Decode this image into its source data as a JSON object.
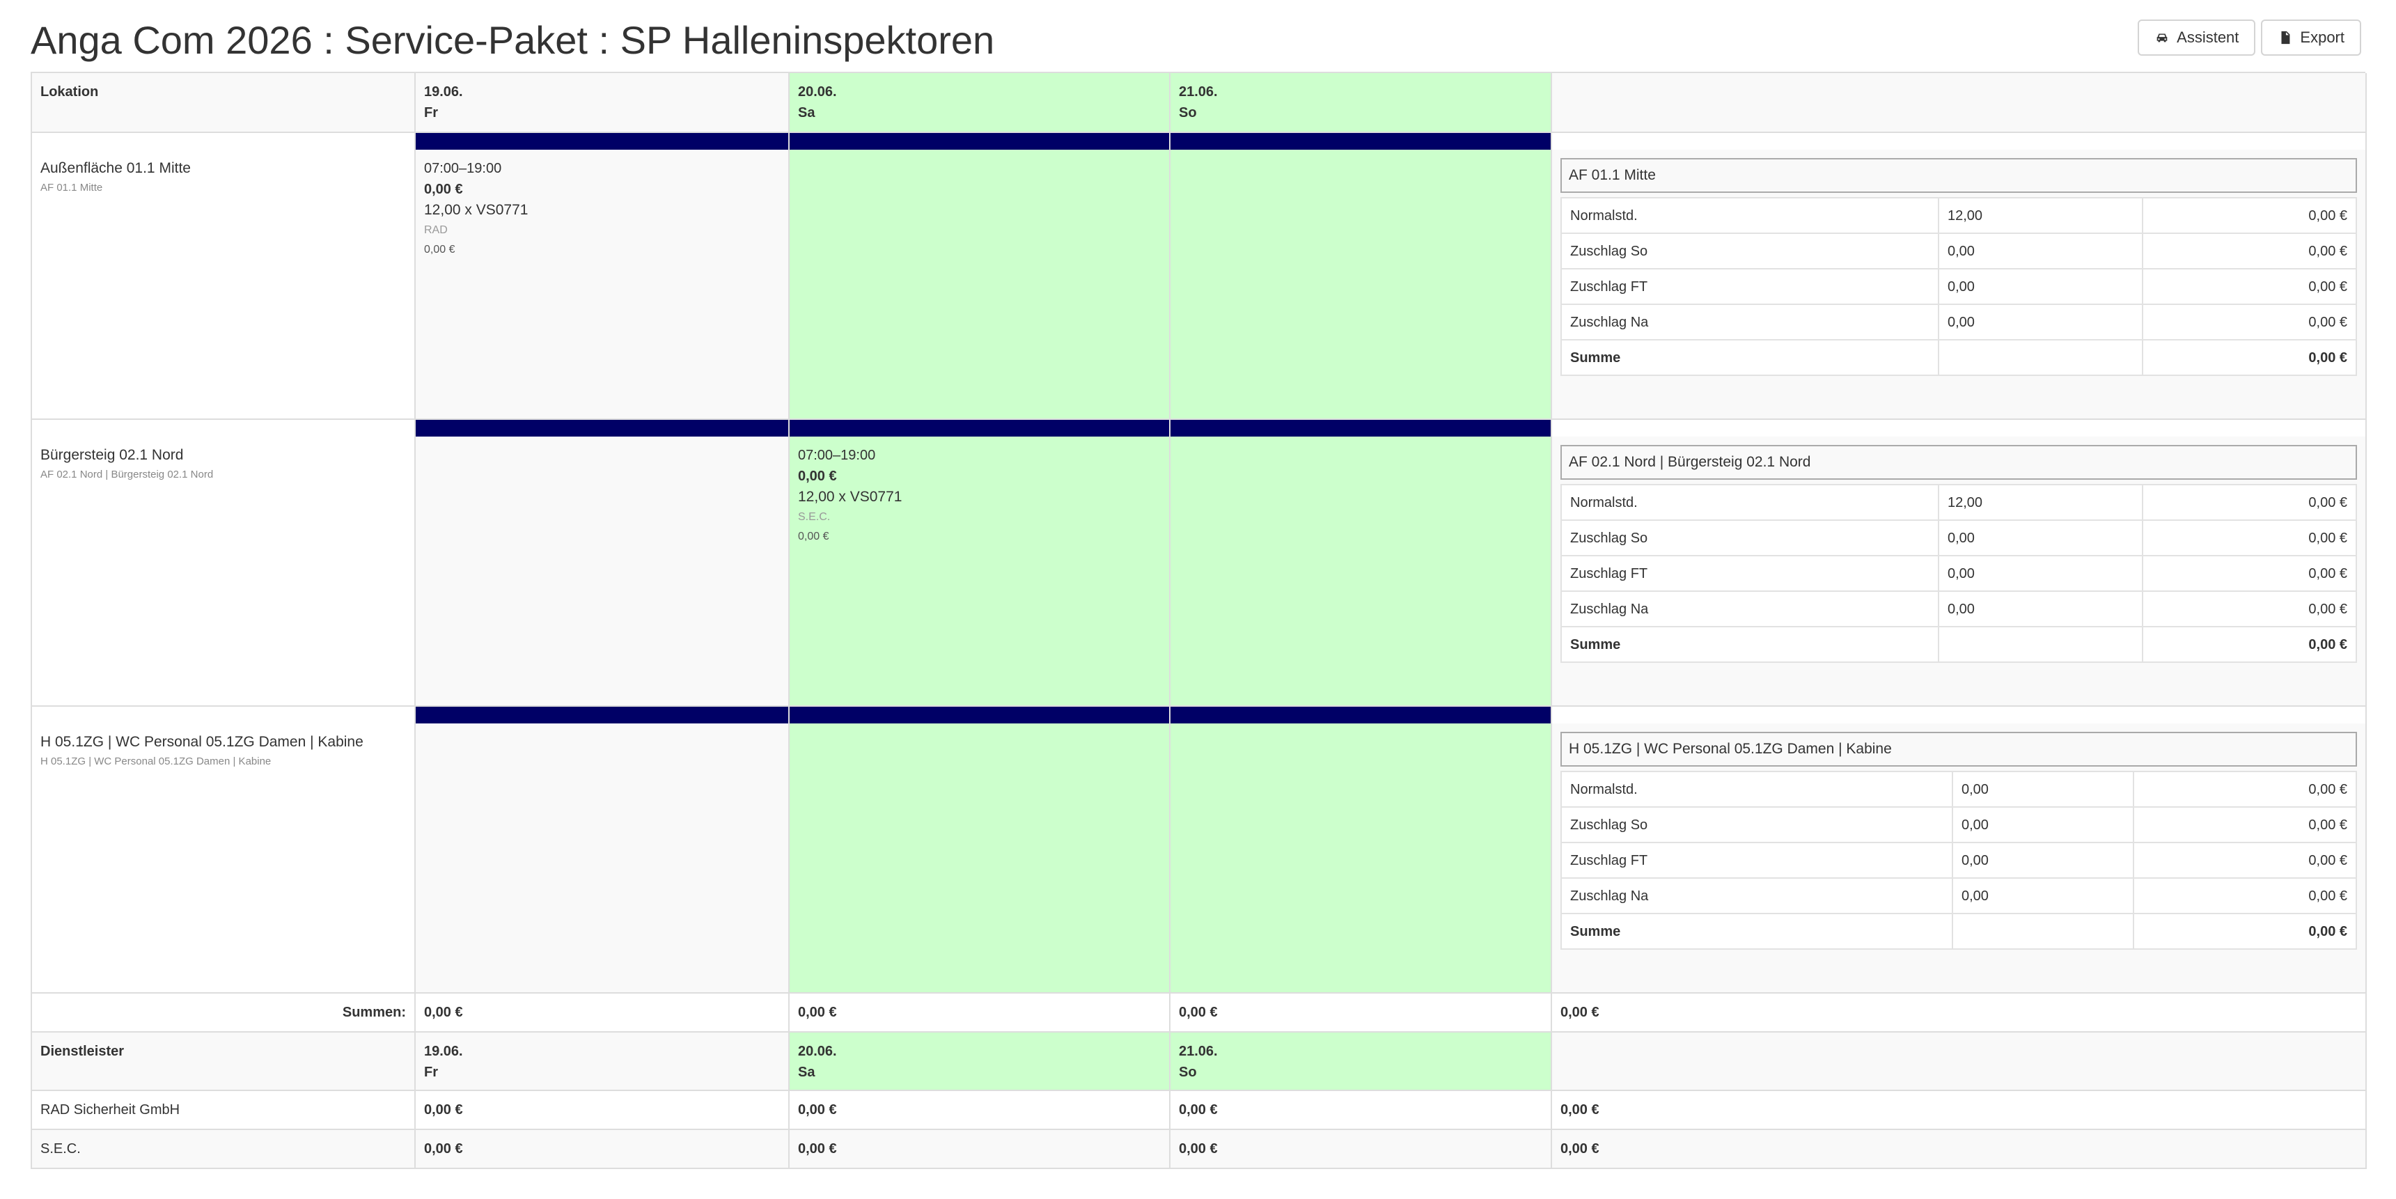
{
  "title": "Anga Com 2026 : Service-Paket : SP Halleninspektoren",
  "toolbar": {
    "assistant_label": "Assistent",
    "export_label": "Export"
  },
  "location_table": {
    "header_label": "Lokation",
    "days": [
      {
        "date": "19.06.",
        "weekday": "Fr"
      },
      {
        "date": "20.06.",
        "weekday": "Sa"
      },
      {
        "date": "21.06.",
        "weekday": "So"
      }
    ],
    "rows": [
      {
        "name": "Außenfläche 01.1 Mitte",
        "sub": "AF 01.1 Mitte",
        "slot": {
          "time": "07:00–19:00",
          "price": "0,00 €",
          "qty": "12,00 x VS0771",
          "provider": "RAD",
          "amount": "0,00 €"
        },
        "summary": {
          "title": "AF 01.1 Mitte",
          "rows": [
            {
              "label": "Normalstd.",
              "qty": "12,00",
              "amount": "0,00 €"
            },
            {
              "label": "Zuschlag So",
              "qty": "0,00",
              "amount": "0,00 €"
            },
            {
              "label": "Zuschlag FT",
              "qty": "0,00",
              "amount": "0,00 €"
            },
            {
              "label": "Zuschlag Na",
              "qty": "0,00",
              "amount": "0,00 €"
            }
          ],
          "total_label": "Summe",
          "total": "0,00 €"
        }
      },
      {
        "name": "Bürgersteig 02.1 Nord",
        "sub": "AF 02.1 Nord | Bürgersteig 02.1 Nord",
        "slot": {
          "time": "07:00–19:00",
          "price": "0,00 €",
          "qty": "12,00 x VS0771",
          "provider": "S.E.C.",
          "amount": "0,00 €"
        },
        "summary": {
          "title": "AF 02.1 Nord | Bürgersteig 02.1 Nord",
          "rows": [
            {
              "label": "Normalstd.",
              "qty": "12,00",
              "amount": "0,00 €"
            },
            {
              "label": "Zuschlag So",
              "qty": "0,00",
              "amount": "0,00 €"
            },
            {
              "label": "Zuschlag FT",
              "qty": "0,00",
              "amount": "0,00 €"
            },
            {
              "label": "Zuschlag Na",
              "qty": "0,00",
              "amount": "0,00 €"
            }
          ],
          "total_label": "Summe",
          "total": "0,00 €"
        }
      },
      {
        "name": "H 05.1ZG | WC Personal 05.1ZG Damen | Kabine",
        "sub": "H 05.1ZG | WC Personal 05.1ZG Damen | Kabine",
        "summary": {
          "title": "H 05.1ZG | WC Personal 05.1ZG Damen | Kabine",
          "rows": [
            {
              "label": "Normalstd.",
              "qty": "0,00",
              "amount": "0,00 €"
            },
            {
              "label": "Zuschlag So",
              "qty": "0,00",
              "amount": "0,00 €"
            },
            {
              "label": "Zuschlag FT",
              "qty": "0,00",
              "amount": "0,00 €"
            },
            {
              "label": "Zuschlag Na",
              "qty": "0,00",
              "amount": "0,00 €"
            }
          ],
          "total_label": "Summe",
          "total": "0,00 €"
        }
      }
    ],
    "sums": {
      "label": "Summen:",
      "values": [
        "0,00 €",
        "0,00 €",
        "0,00 €",
        "0,00 €"
      ]
    }
  },
  "provider_table": {
    "header_label": "Dienstleister",
    "days": [
      {
        "date": "19.06.",
        "weekday": "Fr"
      },
      {
        "date": "20.06.",
        "weekday": "Sa"
      },
      {
        "date": "21.06.",
        "weekday": "So"
      }
    ],
    "rows": [
      {
        "name": "RAD Sicherheit GmbH",
        "values": [
          "0,00 €",
          "0,00 €",
          "0,00 €",
          "0,00 €"
        ]
      },
      {
        "name": "S.E.C.",
        "values": [
          "0,00 €",
          "0,00 €",
          "0,00 €",
          "0,00 €"
        ]
      }
    ]
  },
  "colors": {
    "weekend": "#ccffcc",
    "separator": "#000066",
    "row_grey": "#f9f9f9"
  },
  "icons": {
    "assistant": "car-icon",
    "export": "file-export-icon"
  }
}
